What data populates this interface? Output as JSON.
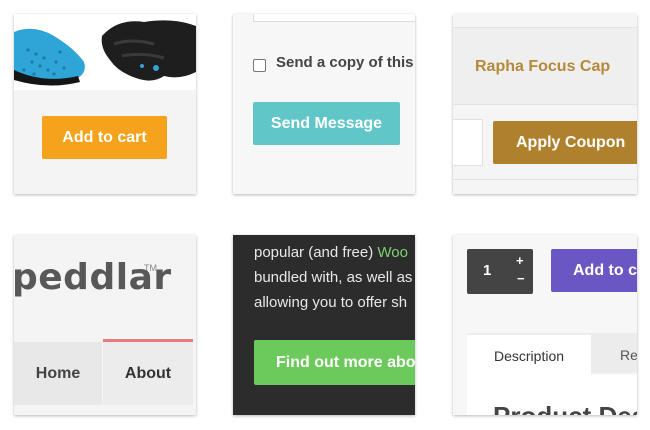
{
  "colors": {
    "add_to_cart_orange": "#f5a21c",
    "send_message_teal": "#60c6c8",
    "apply_coupon_gold": "#b0812d",
    "product_link_gold": "#b5893a",
    "nav_active_red": "#e77b7b",
    "promo_dark_bg": "#2c2c2c",
    "promo_green": "#6cc95b",
    "add_to_cart_purple": "#6b57c4"
  },
  "card_glove": {
    "image_icon": "cycling-glove",
    "add_to_cart_label": "Add to cart"
  },
  "card_contact": {
    "checkbox_checked": false,
    "copy_label": "Send a copy of this e",
    "send_label": "Send Message"
  },
  "card_coupon": {
    "product_name": "Rapha Focus Cap",
    "apply_label": "Apply Coupon"
  },
  "card_peddlar": {
    "logo": "peddlar",
    "trademark": "TM",
    "nav": [
      {
        "label": "Home"
      },
      {
        "label": "About"
      }
    ]
  },
  "card_promo": {
    "line1_before": "popular (and free) ",
    "line1_highlight": "Woo",
    "line2": "bundled with, as well as",
    "line3": "allowing you to offer sh",
    "button_label": "Find out more abou"
  },
  "card_product": {
    "quantity": "1",
    "plus": "+",
    "minus": "−",
    "add_to_cart_label": "Add to ca",
    "tabs": [
      {
        "label": "Description"
      },
      {
        "label": "Re"
      }
    ],
    "heading": "Product Des"
  }
}
